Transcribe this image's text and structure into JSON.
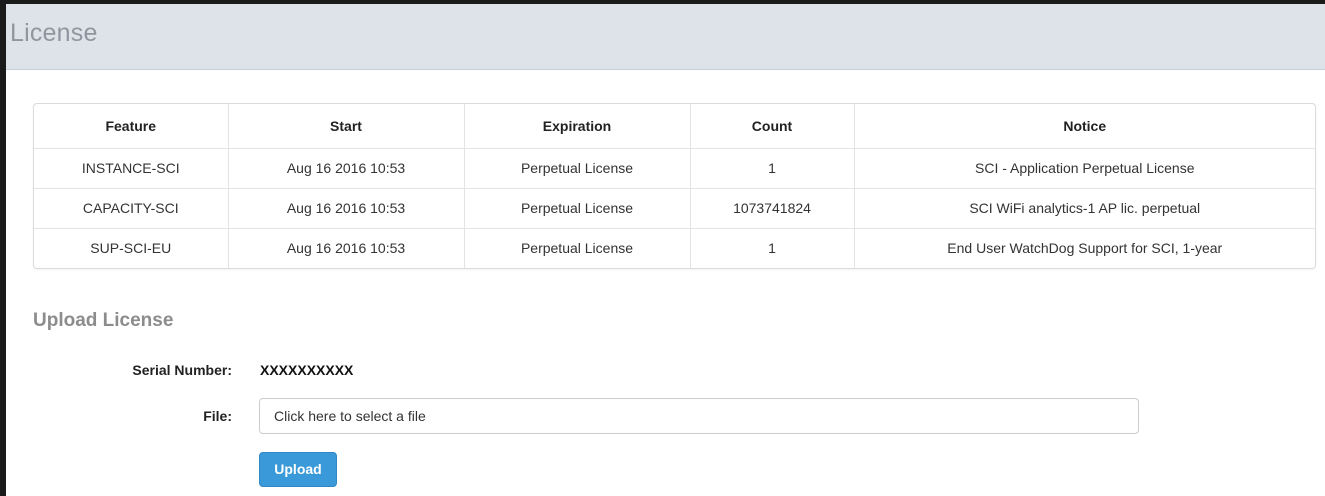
{
  "panel": {
    "title": "License"
  },
  "license_table": {
    "columns": [
      "Feature",
      "Start",
      "Expiration",
      "Count",
      "Notice"
    ],
    "rows": [
      [
        "INSTANCE-SCI",
        "Aug 16 2016 10:53",
        "Perpetual License",
        "1",
        "SCI - Application Perpetual License"
      ],
      [
        "CAPACITY-SCI",
        "Aug 16 2016 10:53",
        "Perpetual License",
        "1073741824",
        "SCI WiFi analytics-1 AP lic. perpetual"
      ],
      [
        "SUP-SCI-EU",
        "Aug 16 2016 10:53",
        "Perpetual License",
        "1",
        "End User WatchDog Support for SCI, 1-year"
      ]
    ]
  },
  "upload": {
    "title": "Upload License",
    "serial_label": "Serial Number:",
    "serial_value": "XXXXXXXXXX",
    "file_label": "File:",
    "file_placeholder": "Click here to select a file",
    "button_label": "Upload",
    "button_color": "#3a9ad9"
  }
}
